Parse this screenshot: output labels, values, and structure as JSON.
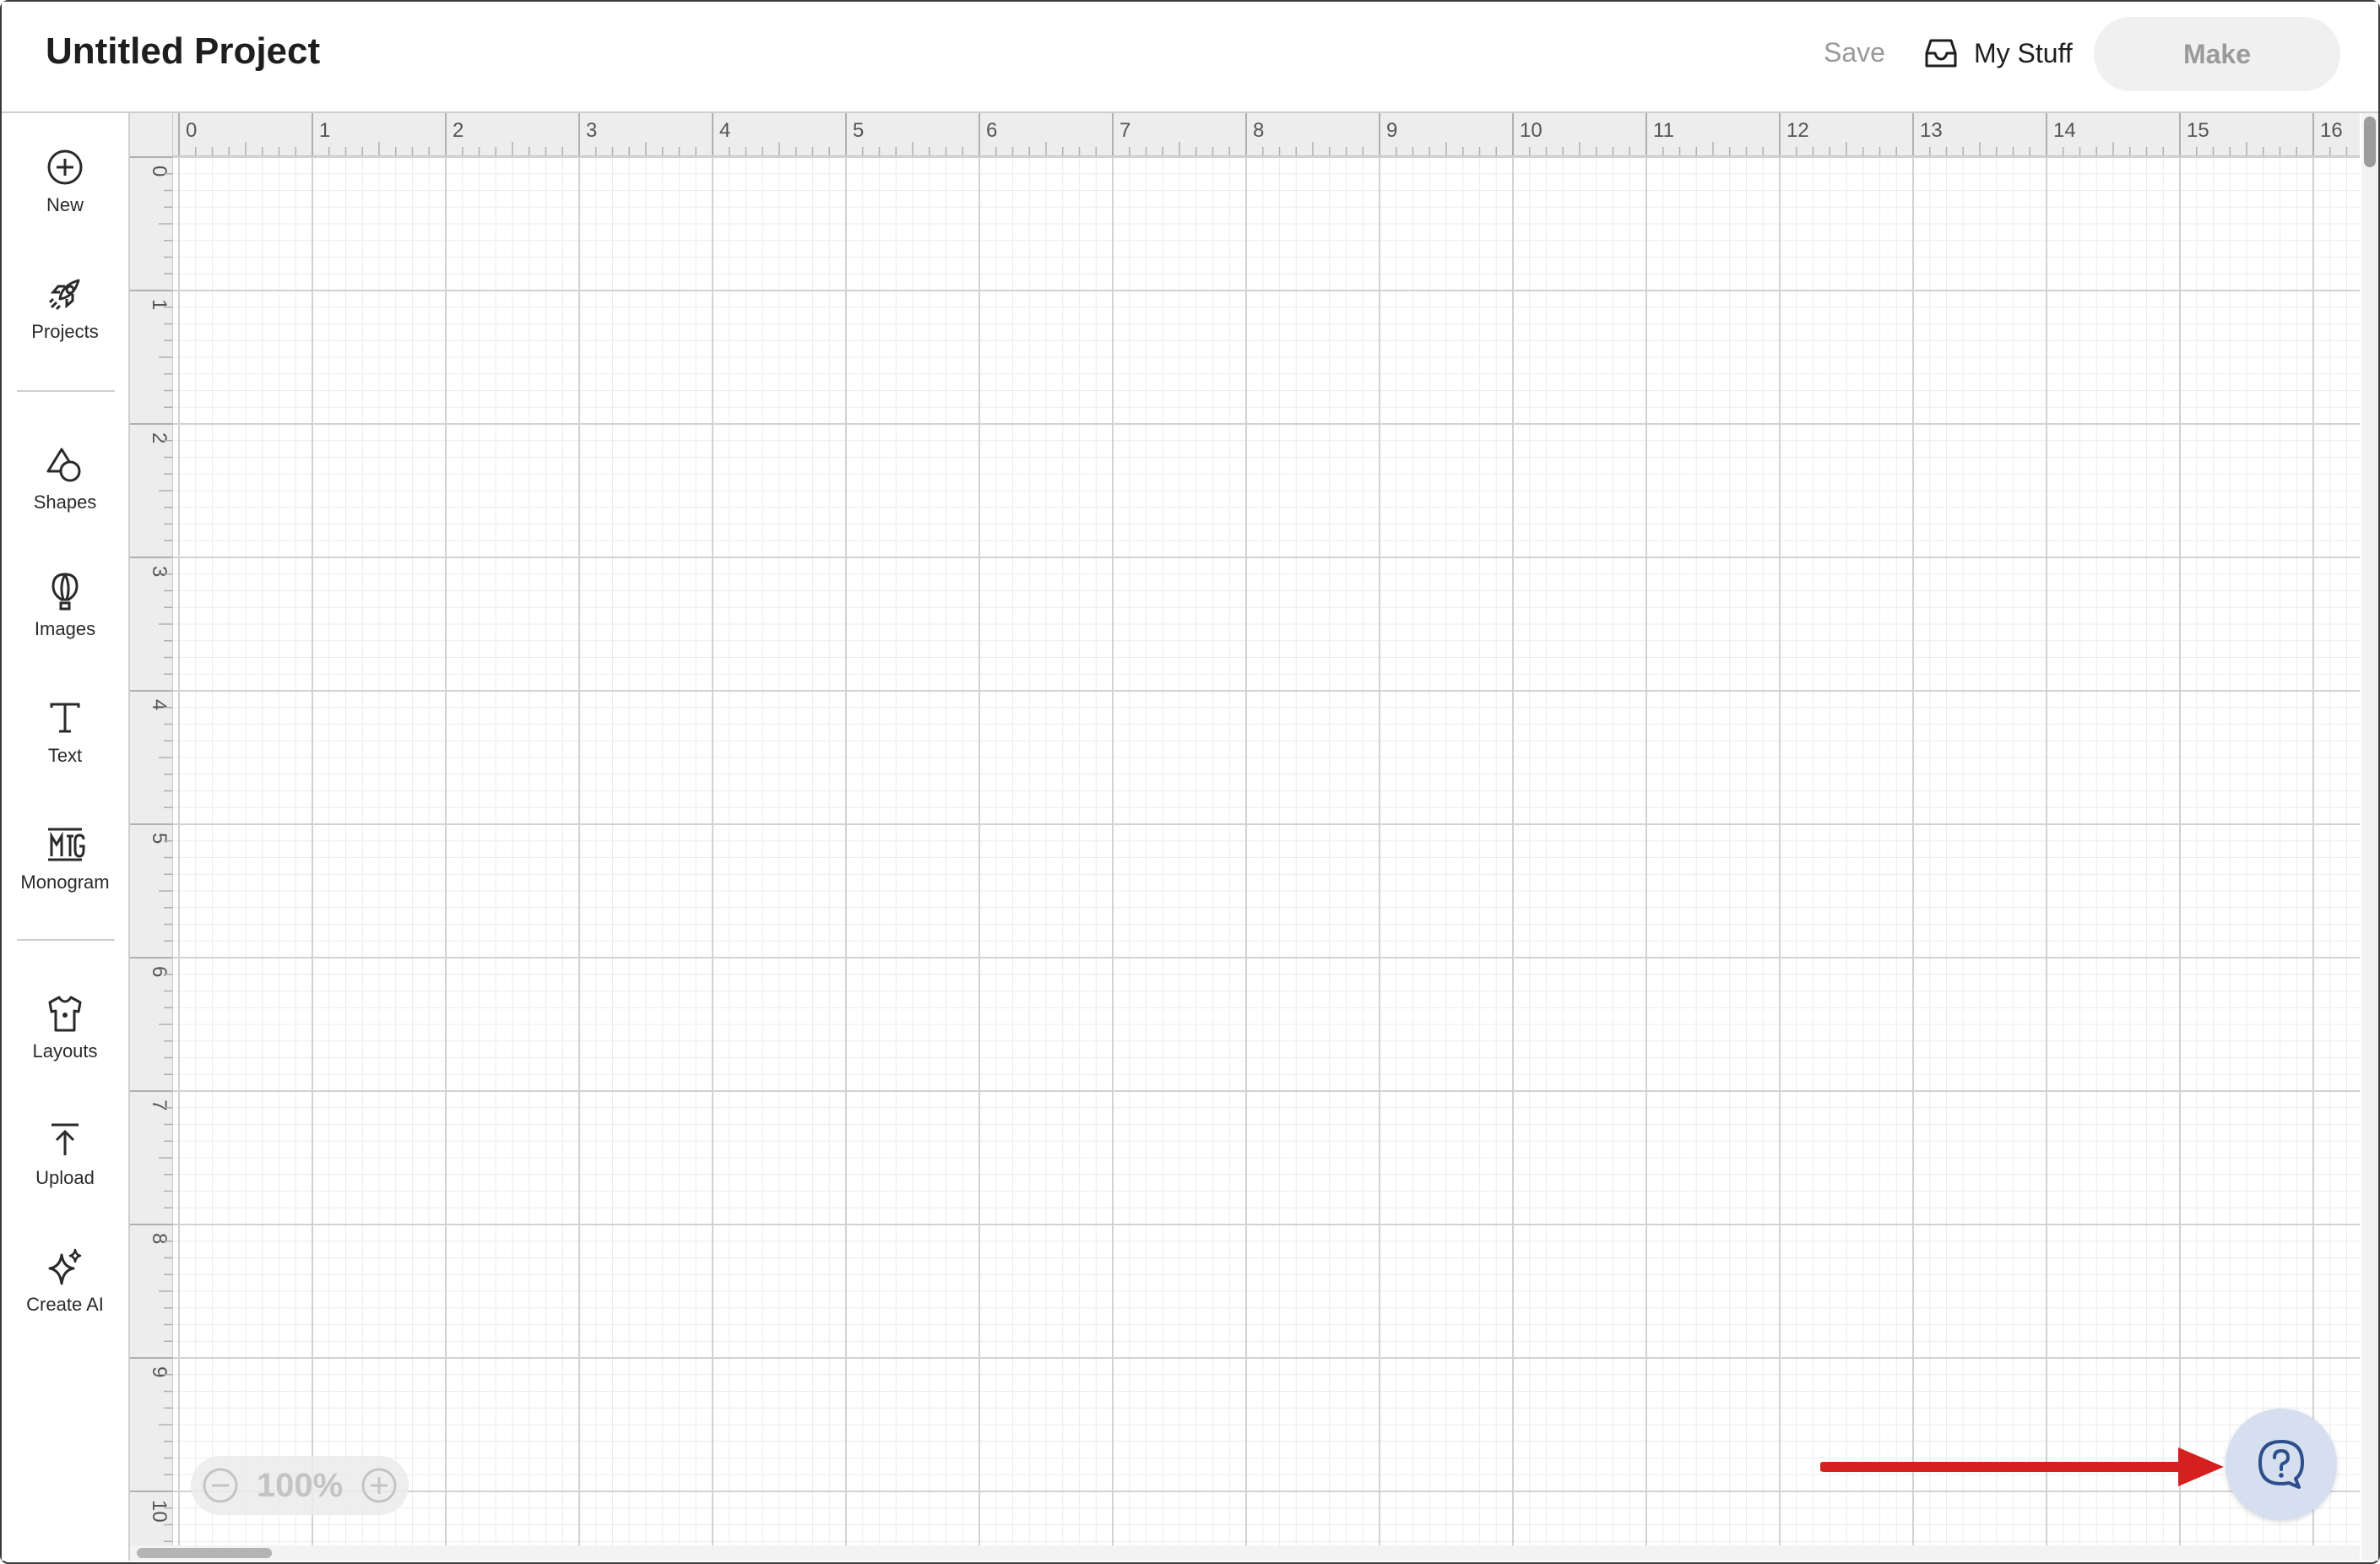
{
  "header": {
    "title": "Untitled Project",
    "save_label": "Save",
    "mystuff_label": "My Stuff",
    "make_label": "Make"
  },
  "sidebar": {
    "items": [
      {
        "label": "New",
        "icon": "plus-circle-icon"
      },
      {
        "label": "Projects",
        "icon": "rocket-icon"
      },
      {
        "label": "Shapes",
        "icon": "shapes-icon"
      },
      {
        "label": "Images",
        "icon": "balloon-icon"
      },
      {
        "label": "Text",
        "icon": "text-t-icon"
      },
      {
        "label": "Monogram",
        "icon": "monogram-icon"
      },
      {
        "label": "Layouts",
        "icon": "tshirt-icon"
      },
      {
        "label": "Upload",
        "icon": "upload-icon"
      },
      {
        "label": "Create AI",
        "icon": "sparkle-icon"
      }
    ]
  },
  "ruler": {
    "x_labels": [
      "0",
      "1",
      "2",
      "3",
      "4",
      "5",
      "6",
      "7",
      "8",
      "9",
      "10",
      "11",
      "12",
      "13",
      "14",
      "15",
      "16"
    ],
    "y_labels": [
      "0",
      "1",
      "2",
      "3",
      "4",
      "5",
      "6",
      "7",
      "8",
      "9",
      "10"
    ]
  },
  "zoom": {
    "value": "100%"
  },
  "help": {
    "icon": "help-chat-icon"
  },
  "annotation": {
    "arrow_color": "#d62020"
  },
  "colors": {
    "grid_minor": "#ececec",
    "grid_major": "#d2d2d2",
    "ruler_bg": "#ededed",
    "help_bg": "#d5dff0",
    "help_icon": "#2d4f8c"
  }
}
